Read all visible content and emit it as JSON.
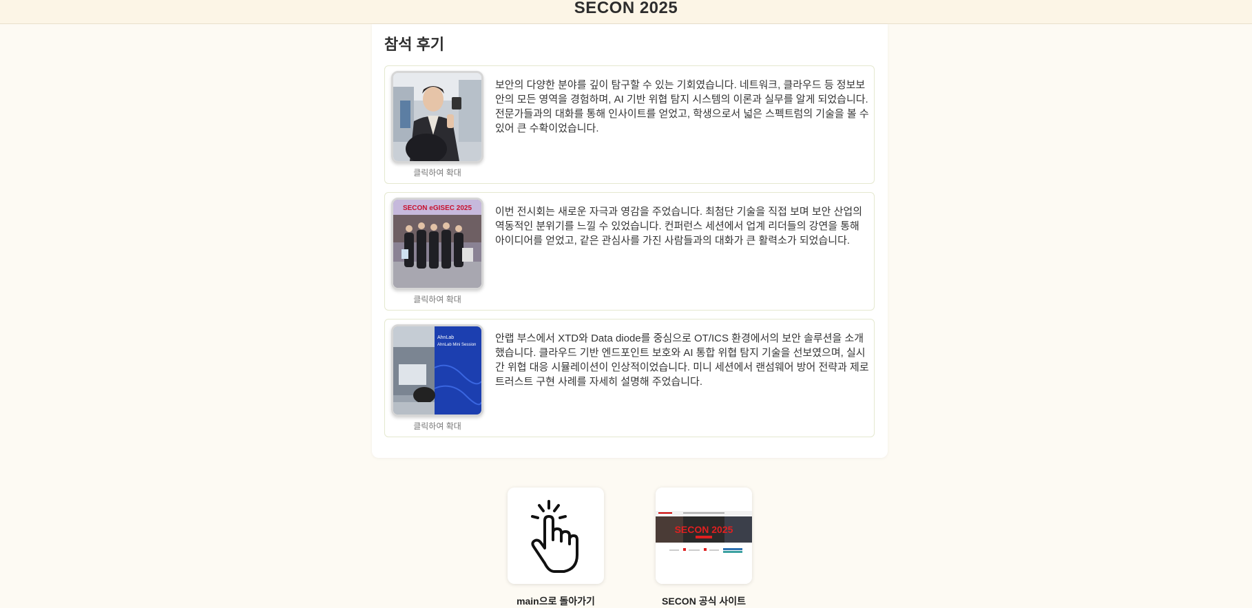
{
  "header": {
    "title": "SECON 2025"
  },
  "section": {
    "title": "참석 후기"
  },
  "reviews": [
    {
      "image_icon": "person-selfie-photo",
      "caption": "클릭하여 확대",
      "text": "보안의 다양한 분야를 깊이 탐구할 수 있는 기회였습니다. 네트워크, 클라우드 등 정보보안의 모든 영역을 경험하며, AI 기반 위협 탐지 시스템의 이론과 실무를 알게 되었습니다. 전문가들과의 대화를 통해 인사이트를 얻었고, 학생으로서 넓은 스펙트럼의 기술을 볼 수 있어 큰 수확이었습니다."
    },
    {
      "image_icon": "group-photo",
      "image_banner": "SECON eGISEC 2025",
      "caption": "클릭하여 확대",
      "text": "이번 전시회는 새로운 자극과 영감을 주었습니다. 최첨단 기술을 직접 보며 보안 산업의 역동적인 분위기를 느낄 수 있었습니다. 컨퍼런스 세션에서 업계 리더들의 강연을 통해 아이디어를 얻었고, 같은 관심사를 가진 사람들과의 대화가 큰 활력소가 되었습니다."
    },
    {
      "image_icon": "booth-photo",
      "image_banner": "AhnLab Mini Session",
      "caption": "클릭하여 확대",
      "text": "안랩 부스에서 XTD와 Data diode를 중심으로 OT/ICS 환경에서의 보안 솔루션을 소개했습니다. 클라우드 기반 엔드포인트 보호와 AI 통합 위협 탐지 기술을 선보였으며, 실시간 위협 대응 시뮬레이션이 인상적이었습니다. 미니 세션에서 랜섬웨어 방어 전략과 제로 트러스트 구현 사례를 자세히 설명해 주었습니다."
    }
  ],
  "links": [
    {
      "icon": "click-hand-icon",
      "label": "main으로 돌아가기"
    },
    {
      "icon": "website-thumbnail",
      "thumbnail_text": "SECON 2025",
      "label": "SECON 공식 사이트"
    }
  ]
}
